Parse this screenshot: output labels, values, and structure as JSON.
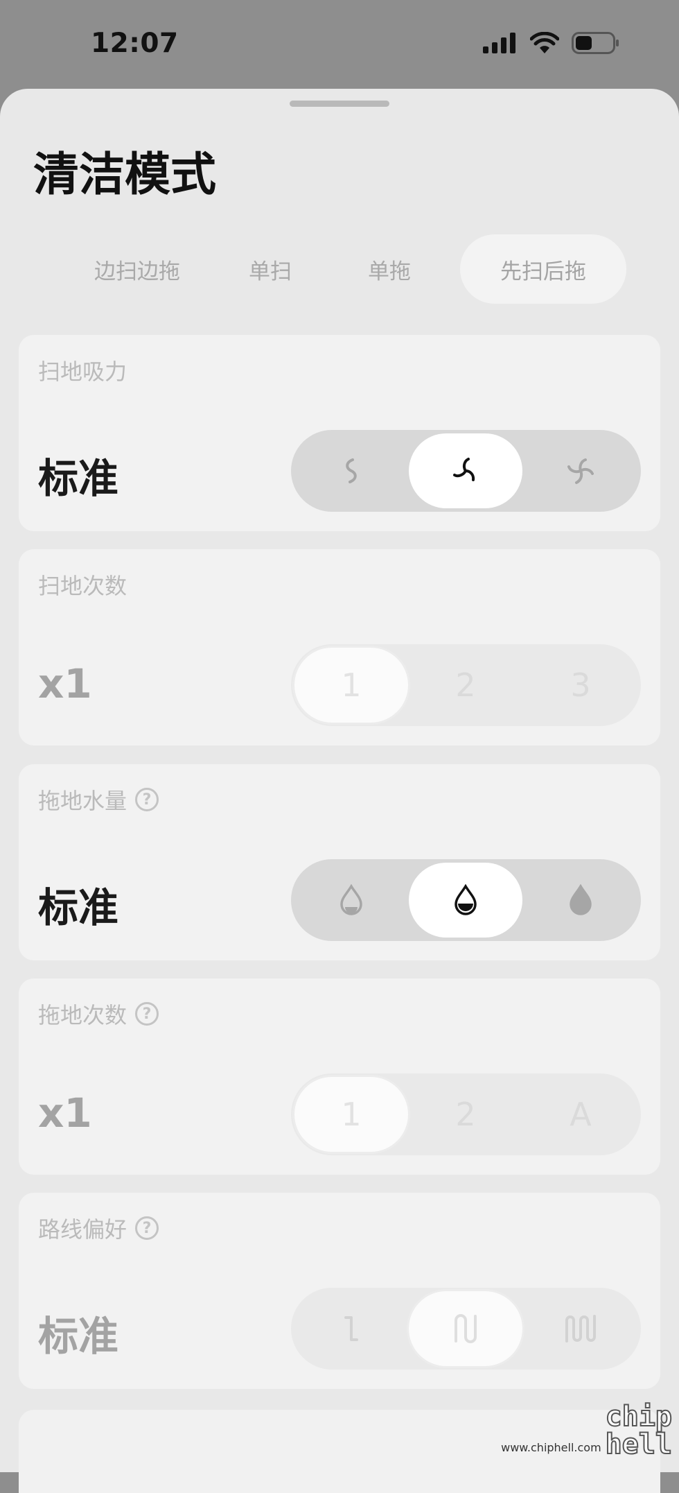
{
  "status_bar": {
    "time": "12:07",
    "battery_level": 0.45
  },
  "sheet": {
    "title": "清洁模式"
  },
  "tabs": [
    {
      "label": "边扫边拖",
      "active": false
    },
    {
      "label": "单扫",
      "active": false
    },
    {
      "label": "单拖",
      "active": false
    },
    {
      "label": "先扫后拖",
      "active": true
    }
  ],
  "settings": [
    {
      "label": "扫地吸力",
      "value": "标准",
      "has_help": false,
      "dimmed": false,
      "options": [
        {
          "icon": "fan-low-icon"
        },
        {
          "icon": "fan-standard-icon",
          "selected": true
        },
        {
          "icon": "fan-high-icon"
        }
      ]
    },
    {
      "label": "扫地次数",
      "value": "x1",
      "has_help": false,
      "dimmed": true,
      "options": [
        {
          "text": "1",
          "selected": true
        },
        {
          "text": "2"
        },
        {
          "text": "3"
        }
      ]
    },
    {
      "label": "拖地水量",
      "value": "标准",
      "has_help": true,
      "dimmed": false,
      "options": [
        {
          "icon": "water-drop-low-icon"
        },
        {
          "icon": "water-drop-standard-icon",
          "selected": true
        },
        {
          "icon": "water-drop-high-icon"
        }
      ]
    },
    {
      "label": "拖地次数",
      "value": "x1",
      "has_help": true,
      "dimmed": true,
      "options": [
        {
          "text": "1",
          "selected": true
        },
        {
          "text": "2"
        },
        {
          "text": "A"
        }
      ]
    },
    {
      "label": "路线偏好",
      "value": "标准",
      "has_help": true,
      "dimmed": true,
      "options": [
        {
          "icon": "route-simple-icon"
        },
        {
          "icon": "route-standard-icon",
          "selected": true
        },
        {
          "icon": "route-dense-icon"
        }
      ]
    }
  ],
  "watermark": {
    "url": "www.chiphell.com",
    "logo": "chip hell"
  }
}
